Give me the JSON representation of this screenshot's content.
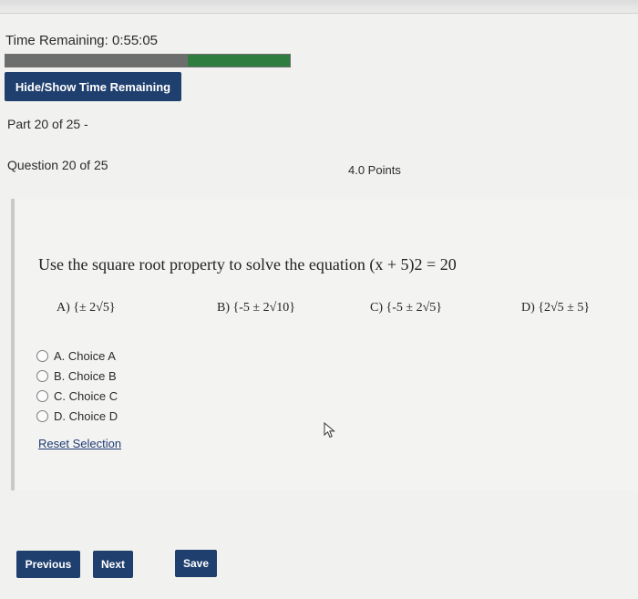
{
  "timer": {
    "label": "Time Remaining: 0:55:05",
    "elapsed_fraction": 0.64
  },
  "buttons": {
    "hide_show": "Hide/Show Time Remaining",
    "previous": "Previous",
    "next": "Next",
    "save": "Save"
  },
  "progress": {
    "part": "Part 20 of 25 -",
    "question": "Question 20 of 25",
    "points": "4.0 Points"
  },
  "question": {
    "text": "Use the square root property to solve the equation (x + 5)2 = 20",
    "answers": [
      "A) {± 2√5}",
      "B) {-5 ± 2√10}",
      "C) {-5 ± 2√5}",
      "D) {2√5 ± 5}"
    ],
    "choices": [
      "A. Choice A",
      "B. Choice B",
      "C. Choice C",
      "D. Choice D"
    ],
    "reset_label": "Reset Selection"
  },
  "colors": {
    "primary_button": "#1f3f6e",
    "timer_remaining": "#2f7d3f",
    "timer_used": "#6b6e6c",
    "link": "#1e3b73"
  },
  "icons": {
    "cursor": "mouse-pointer-icon"
  }
}
